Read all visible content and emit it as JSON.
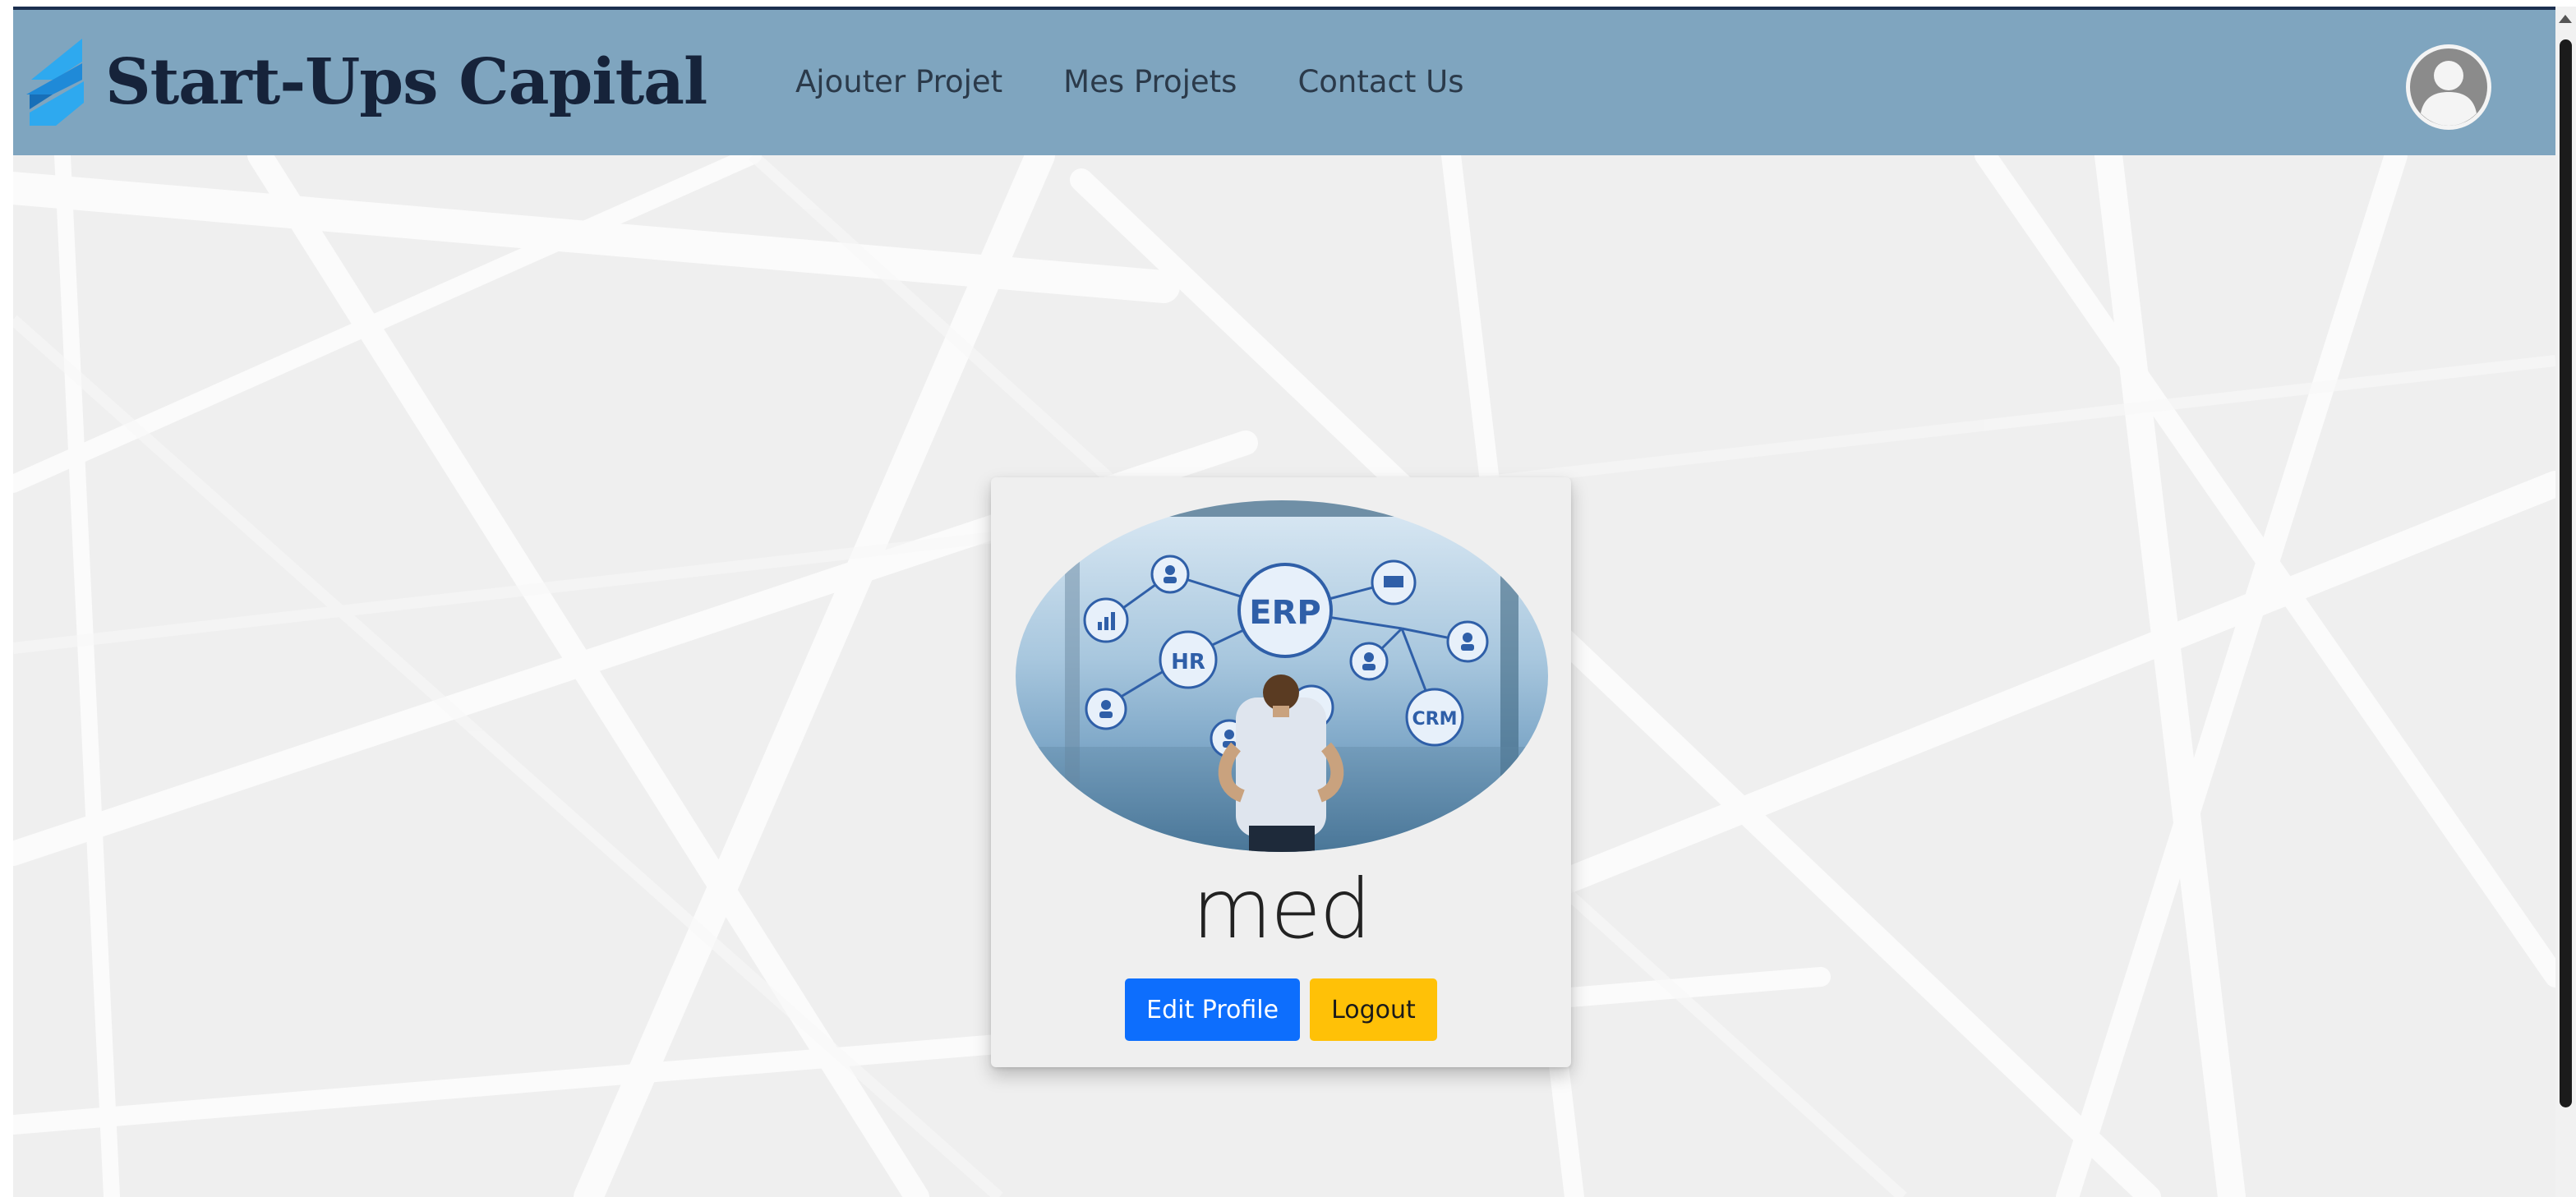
{
  "brand": {
    "name": "Start-Ups Capital",
    "logo_icon": "stacked-layers-logo"
  },
  "nav": {
    "links": [
      {
        "label": "Ajouter Projet"
      },
      {
        "label": "Mes Projets"
      },
      {
        "label": "Contact Us"
      }
    ],
    "user_icon": "user-avatar-icon"
  },
  "profile": {
    "image_labels": {
      "center": "ERP",
      "left": "HR",
      "right": "CRM"
    },
    "username": "med",
    "edit_button": "Edit Profile",
    "logout_button": "Logout"
  },
  "colors": {
    "navbar": "#7fa5bf",
    "brand_text": "#16233a",
    "primary": "#0d6efd",
    "warning": "#ffc107",
    "background": "#efefef"
  }
}
